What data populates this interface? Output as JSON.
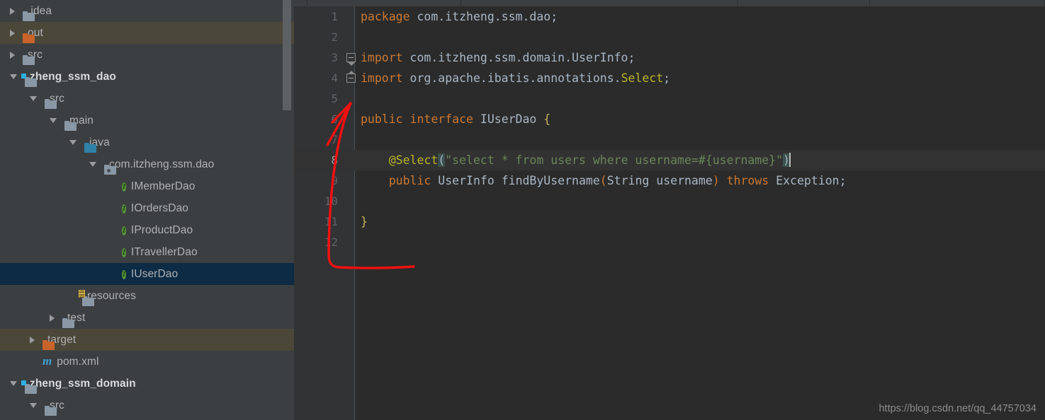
{
  "sidebar": {
    "name": "project-tree",
    "scrollbar": {
      "visible": true
    },
    "items": [
      {
        "label": ".idea",
        "indent": 0,
        "arrow": "right",
        "icon": "folder-gray",
        "state": "normal",
        "bold": false
      },
      {
        "label": "out",
        "indent": 0,
        "arrow": "right",
        "icon": "folder-orange",
        "state": "excluded",
        "bold": false
      },
      {
        "label": "src",
        "indent": 0,
        "arrow": "right",
        "icon": "folder-gray",
        "state": "normal",
        "bold": false
      },
      {
        "label": "zheng_ssm_dao",
        "indent": 0,
        "arrow": "down",
        "icon": "folder-module",
        "state": "normal",
        "bold": true
      },
      {
        "label": "src",
        "indent": 1,
        "arrow": "down",
        "icon": "folder-gray",
        "state": "normal",
        "bold": false
      },
      {
        "label": "main",
        "indent": 2,
        "arrow": "down",
        "icon": "folder-gray",
        "state": "normal",
        "bold": false
      },
      {
        "label": "java",
        "indent": 3,
        "arrow": "down",
        "icon": "folder-source-blue",
        "state": "normal",
        "bold": false
      },
      {
        "label": "com.itzheng.ssm.dao",
        "indent": 4,
        "arrow": "down",
        "icon": "folder-package",
        "state": "normal",
        "bold": false
      },
      {
        "label": "IMemberDao",
        "indent": 5,
        "arrow": "none",
        "icon": "interface-icon",
        "state": "normal",
        "bold": false
      },
      {
        "label": "IOrdersDao",
        "indent": 5,
        "arrow": "none",
        "icon": "interface-icon",
        "state": "normal",
        "bold": false
      },
      {
        "label": "IProductDao",
        "indent": 5,
        "arrow": "none",
        "icon": "interface-icon",
        "state": "normal",
        "bold": false
      },
      {
        "label": "ITravellerDao",
        "indent": 5,
        "arrow": "none",
        "icon": "interface-icon",
        "state": "normal",
        "bold": false
      },
      {
        "label": "IUserDao",
        "indent": 5,
        "arrow": "none",
        "icon": "interface-icon",
        "state": "selected",
        "bold": false
      },
      {
        "label": "resources",
        "indent": 3,
        "arrow": "none",
        "icon": "folder-resources",
        "state": "normal",
        "bold": false
      },
      {
        "label": "test",
        "indent": 2,
        "arrow": "right",
        "icon": "folder-gray",
        "state": "normal",
        "bold": false
      },
      {
        "label": "target",
        "indent": 1,
        "arrow": "right",
        "icon": "folder-orange",
        "state": "excluded",
        "bold": false
      },
      {
        "label": "pom.xml",
        "indent": 1,
        "arrow": "none",
        "icon": "maven-icon",
        "state": "normal",
        "bold": false
      },
      {
        "label": "zheng_ssm_domain",
        "indent": 0,
        "arrow": "down",
        "icon": "folder-module",
        "state": "normal",
        "bold": true
      },
      {
        "label": "src",
        "indent": 1,
        "arrow": "down",
        "icon": "folder-gray",
        "state": "normal",
        "bold": false
      }
    ]
  },
  "editor": {
    "name": "code-editor",
    "language": "java",
    "current_line": 8,
    "line_count": 12,
    "lines": [
      {
        "n": "1",
        "fold": "none"
      },
      {
        "n": "2",
        "fold": "none"
      },
      {
        "n": "3",
        "fold": "start"
      },
      {
        "n": "4",
        "fold": "end"
      },
      {
        "n": "5",
        "fold": "none"
      },
      {
        "n": "6",
        "fold": "none"
      },
      {
        "n": "7",
        "fold": "none"
      },
      {
        "n": "8",
        "fold": "none"
      },
      {
        "n": "9",
        "fold": "none"
      },
      {
        "n": "10",
        "fold": "none"
      },
      {
        "n": "11",
        "fold": "none"
      },
      {
        "n": "12",
        "fold": "none"
      }
    ],
    "code": {
      "l1_kw": "package",
      "l1_rest": " com.itzheng.ssm.dao;",
      "l3_kw": "import",
      "l3_rest": " com.itzheng.ssm.domain.UserInfo;",
      "l4_kw": "import",
      "l4_rest": " org.apache.ibatis.annotations.",
      "l4_ann": "Select",
      "l4_semi": ";",
      "l6_kw": "public interface",
      "l6_name": " IUserDao ",
      "l6_brace": "{",
      "l8_ann": "    @Select",
      "l8_lparen": "(",
      "l8_str": "\"select * from users where username=#{username}\"",
      "l8_rparen": ")",
      "l9_kw1": "    public ",
      "l9_type1": "UserInfo",
      "l9_method": " findByUsername",
      "l9_lparen": "(",
      "l9_type2": "String",
      "l9_param": " username",
      "l9_rparen": ")",
      "l9_kw2": " throws ",
      "l9_type3": "Exception",
      "l9_semi": ";",
      "l11_brace": "}"
    }
  },
  "watermark": {
    "text": "https://blog.csdn.net/qq_44757034"
  },
  "annotation": {
    "type": "hand-drawn-arrow",
    "color": "#F41010",
    "description": "red arrow from IUserDao tree node curving up into the editor"
  },
  "colors": {
    "sidebar_bg": "#3C3F41",
    "editor_bg": "#2B2B2B",
    "gutter_bg": "#313335",
    "selection_bg": "#0D2B45",
    "excluded_bg": "#4B4739",
    "current_line_bg": "#323232",
    "keyword": "#CC7832",
    "string": "#6A8759",
    "annotation": "#BBB529",
    "identifier": "#A9B7C6",
    "brace": "#C9B458",
    "line_number": "#606366",
    "accent_arrow": "#F41010"
  }
}
